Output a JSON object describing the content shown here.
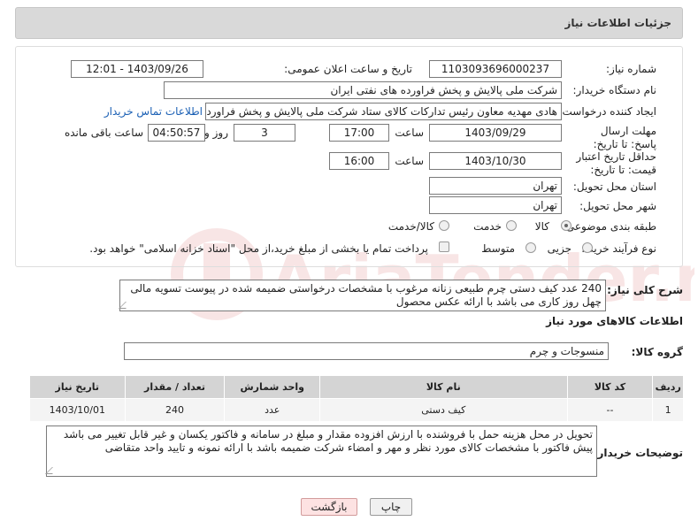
{
  "header": {
    "title": "جزئیات اطلاعات نیاز"
  },
  "need_number": {
    "label": "شماره نیاز:",
    "value": "1103093696000237"
  },
  "announce": {
    "label": "تاریخ و ساعت اعلان عمومی:",
    "value": "1403/09/26 - 12:01"
  },
  "buyer_org": {
    "label": "نام دستگاه خریدار:",
    "value": "شرکت ملی پالایش و پخش فراورده های نفتی ایران"
  },
  "creator": {
    "label": "ایجاد کننده درخواست:",
    "value": "هادی مهدیه معاون رئیس تدارکات کالای ستاد شرکت ملی پالایش و پخش فراورد",
    "contact_link": "اطلاعات تماس خریدار"
  },
  "response_deadline": {
    "label": "مهلت ارسال پاسخ: تا تاریخ:",
    "date": "1403/09/29",
    "time_label": "ساعت",
    "time": "17:00",
    "days": "3",
    "days_label": "روز و",
    "remaining": "04:50:57",
    "remaining_label": "ساعت باقی مانده"
  },
  "price_validity": {
    "label": "حداقل تاریخ اعتبار قیمت: تا تاریخ:",
    "date": "1403/10/30",
    "time_label": "ساعت",
    "time": "16:00"
  },
  "province": {
    "label": "استان محل تحویل:",
    "value": "تهران"
  },
  "city": {
    "label": "شهر محل تحویل:",
    "value": "تهران"
  },
  "category": {
    "label": "طبقه بندی موضوعی:",
    "options": [
      "کالا",
      "خدمت",
      "کالا/خدمت"
    ],
    "selected": "کالا"
  },
  "process": {
    "label": "نوع فرآیند خرید :",
    "options": [
      "جزیی",
      "متوسط"
    ],
    "payment_note": "پرداخت تمام یا بخشی از مبلغ خرید،از محل \"اسناد خزانه اسلامی\" خواهد بود."
  },
  "summary": {
    "label": "شرح کلی نیاز:",
    "text": "240 عدد کیف دستی چرم طبیعی زنانه مرغوب با مشخصات درخواستی ضمیمه شده در پیوست تسویه مالی چهل روز کاری می باشد با ارائه عکس محصول"
  },
  "goods_info": {
    "title": "اطلاعات کالاهای مورد نیاز"
  },
  "goods_group": {
    "label": "گروه کالا:",
    "value": "منسوجات و چرم"
  },
  "table": {
    "headers": [
      "ردیف",
      "کد کالا",
      "نام کالا",
      "واحد شمارش",
      "تعداد / مقدار",
      "تاریخ نیاز"
    ],
    "rows": [
      [
        "1",
        "--",
        "کیف دستی",
        "عدد",
        "240",
        "1403/10/01"
      ]
    ]
  },
  "buyer_notes": {
    "label": "توضیحات خریدار:",
    "text": "تحویل در محل هزینه حمل با فروشنده با ارزش افزوده مقدار و مبلغ در سامانه و فاکتور یکسان و غیر قابل تغییر می باشد پیش فاکتور با مشخصات کالای مورد نظر و مهر و امضاء شرکت ضمیمه باشد با ارائه نمونه و تایید واحد متقاضی"
  },
  "buttons": {
    "print": "چاپ",
    "back": "بازگشت"
  },
  "watermark": {
    "text": "AriaTender.neT"
  }
}
